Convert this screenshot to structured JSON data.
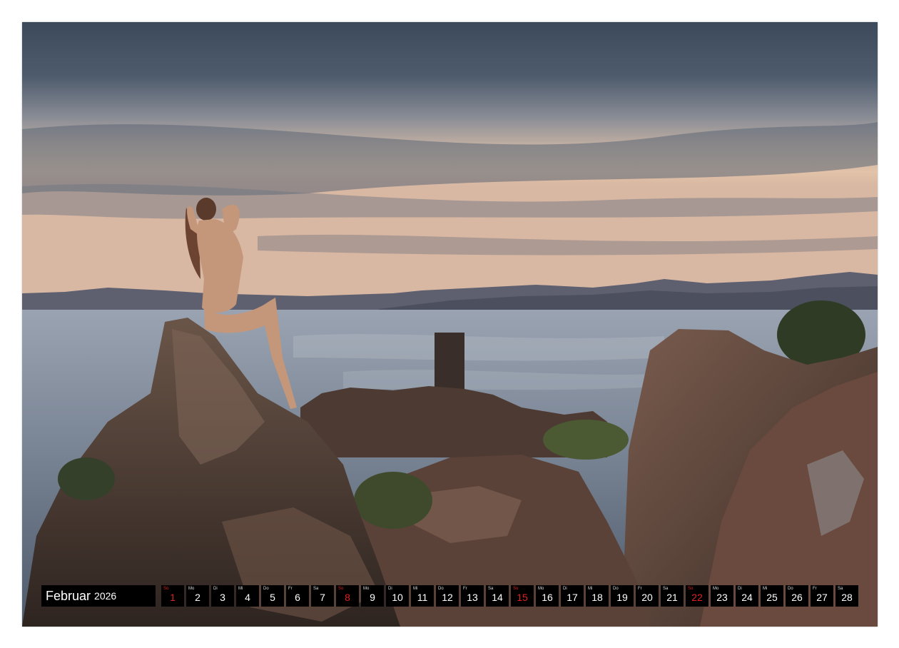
{
  "calendar": {
    "month": "Februar",
    "year": "2026",
    "days": [
      {
        "wd": "So",
        "num": "1",
        "sunday": true
      },
      {
        "wd": "Mo",
        "num": "2"
      },
      {
        "wd": "Di",
        "num": "3"
      },
      {
        "wd": "Mi",
        "num": "4"
      },
      {
        "wd": "Do",
        "num": "5"
      },
      {
        "wd": "Fr",
        "num": "6"
      },
      {
        "wd": "Sa",
        "num": "7"
      },
      {
        "wd": "So",
        "num": "8",
        "sunday": true
      },
      {
        "wd": "Mo",
        "num": "9"
      },
      {
        "wd": "Di",
        "num": "10"
      },
      {
        "wd": "Mi",
        "num": "11"
      },
      {
        "wd": "Do",
        "num": "12"
      },
      {
        "wd": "Fr",
        "num": "13"
      },
      {
        "wd": "Sa",
        "num": "14"
      },
      {
        "wd": "So",
        "num": "15",
        "sunday": true
      },
      {
        "wd": "Mo",
        "num": "16"
      },
      {
        "wd": "Di",
        "num": "17"
      },
      {
        "wd": "Mi",
        "num": "18"
      },
      {
        "wd": "Do",
        "num": "19"
      },
      {
        "wd": "Fr",
        "num": "20"
      },
      {
        "wd": "Sa",
        "num": "21"
      },
      {
        "wd": "So",
        "num": "22",
        "sunday": true
      },
      {
        "wd": "Mo",
        "num": "23"
      },
      {
        "wd": "Di",
        "num": "24"
      },
      {
        "wd": "Mi",
        "num": "25"
      },
      {
        "wd": "Do",
        "num": "26"
      },
      {
        "wd": "Fr",
        "num": "27"
      },
      {
        "wd": "Sa",
        "num": "28"
      }
    ]
  },
  "colors": {
    "sunday": "#e02020",
    "strip": "#000000",
    "strip_text": "#ffffff"
  }
}
